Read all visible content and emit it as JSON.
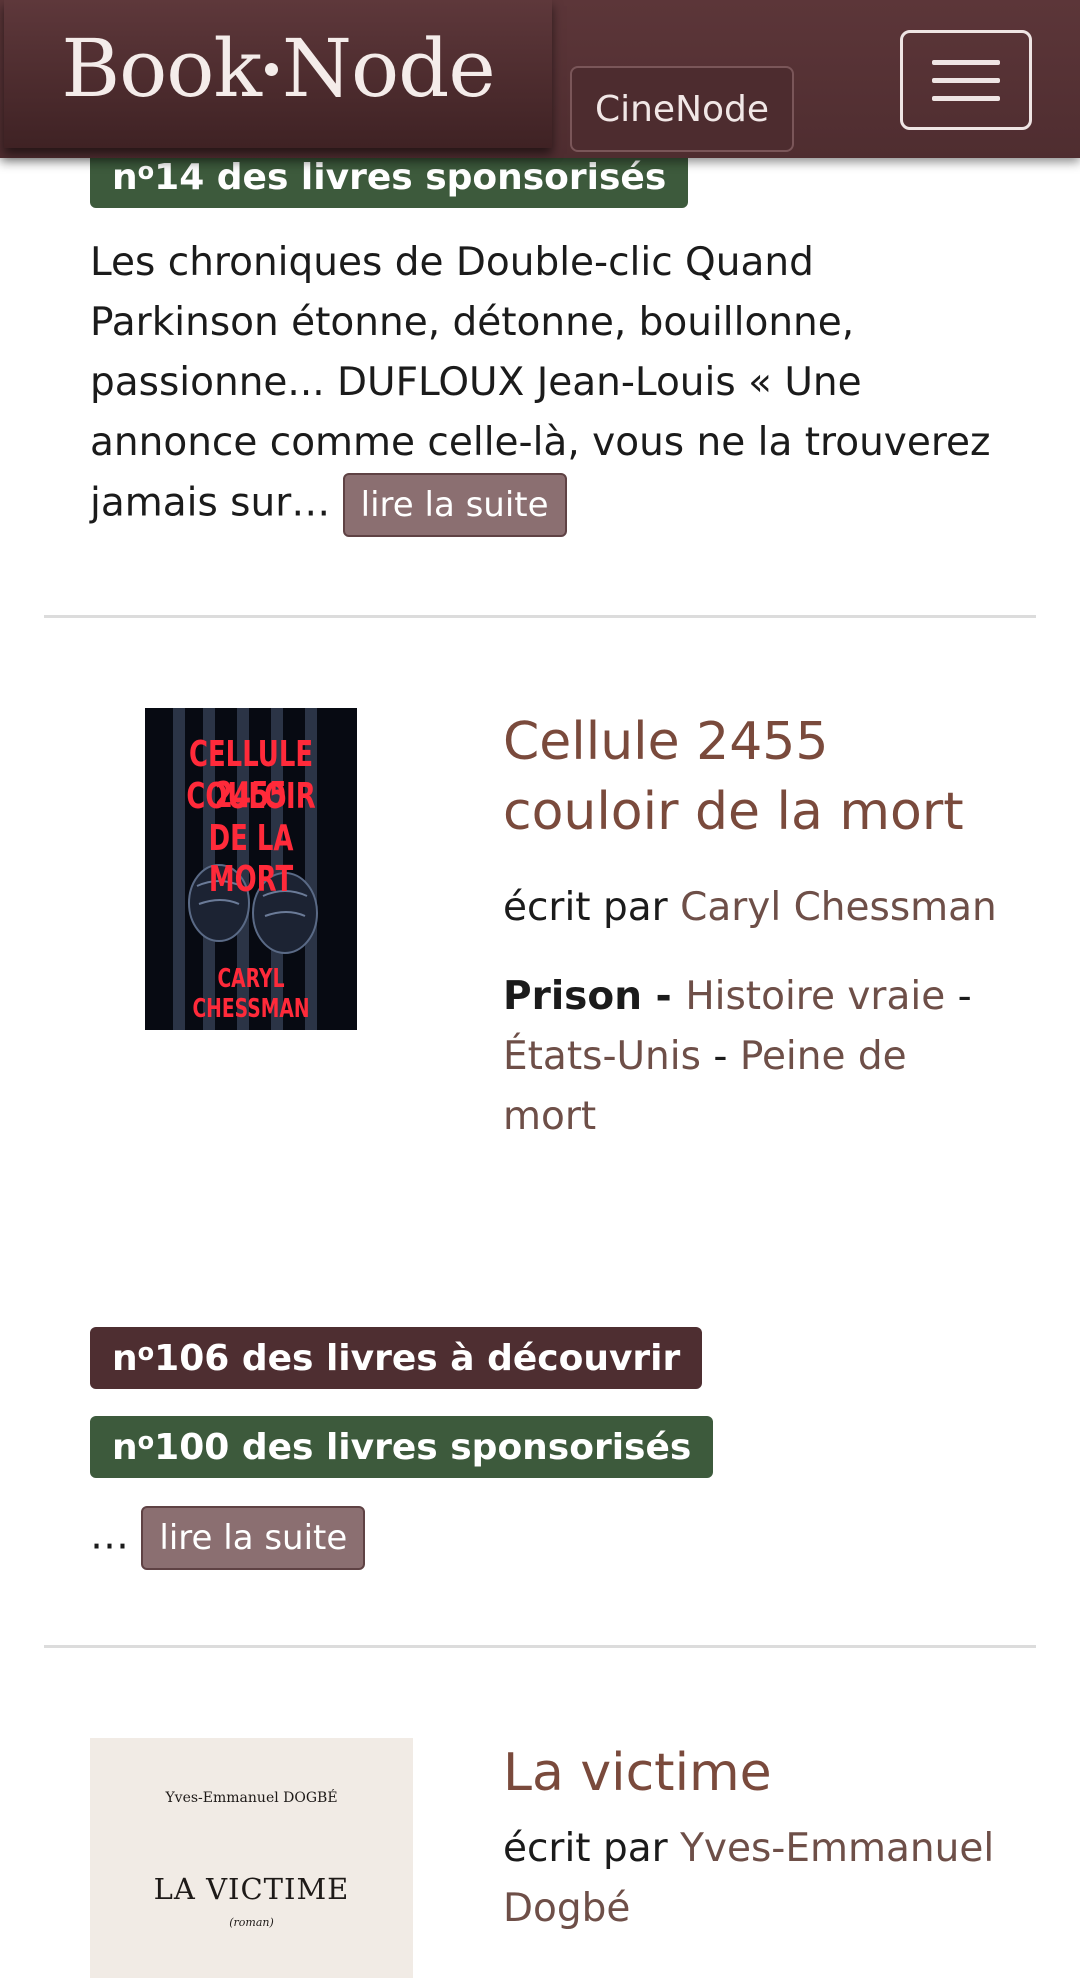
{
  "header": {
    "brand": {
      "part1": "Book",
      "part2": "Node"
    },
    "cinenode_label": "CineNode",
    "menu_icon": "hamburger-menu-icon"
  },
  "entries": [
    {
      "badges": [
        {
          "prefix": "n",
          "sup": "o",
          "text": "14 des livres sponsorisés",
          "color": "#3d5a3c"
        }
      ],
      "description": "Les chroniques de Double-clic Quand Parkinson étonne, détonne, bouillonne, passionne... DUFLOUX Jean-Louis « Une annonce comme celle-là, vous ne la trouverez jamais sur…",
      "read_more": "lire la suite"
    },
    {
      "cover": {
        "line1": "CELLULE 2455",
        "line2": "COULOIR",
        "line3": "DE LA MORT",
        "author_line": "CARYL CHESSMAN"
      },
      "title_line1": "Cellule 2455",
      "title_line2": "couloir de la mort",
      "author_prefix": "écrit par",
      "author": "Caryl Chessman",
      "genre": "Prison",
      "tags": [
        "Histoire vraie",
        "États-Unis",
        "Peine de mort"
      ],
      "badges": [
        {
          "prefix": "n",
          "sup": "o",
          "text": "106 des livres à découvrir",
          "color": "#4e2e31"
        },
        {
          "prefix": "n",
          "sup": "o",
          "text": "100 des livres sponsorisés",
          "color": "#3d5a3c"
        }
      ],
      "description": "…",
      "read_more": "lire la suite"
    },
    {
      "cover": {
        "author_line": "Yves-Emmanuel DOGBÉ",
        "title": "LA VICTIME",
        "subtitle": "(roman)"
      },
      "title": "La victime",
      "author_prefix": "écrit par",
      "author": "Yves-Emmanuel Dogbé"
    }
  ]
}
